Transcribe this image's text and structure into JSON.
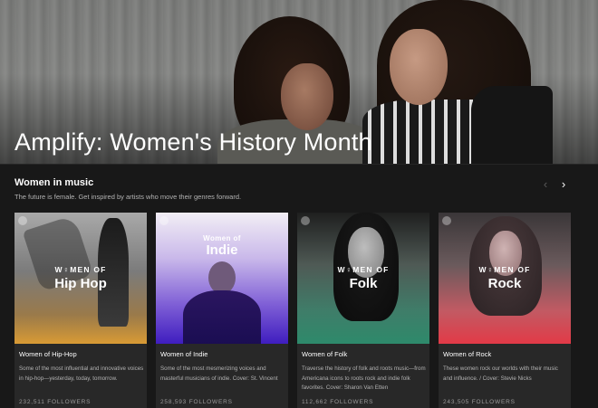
{
  "hero": {
    "title": "Amplify: Women's History Month"
  },
  "section": {
    "title": "Women in music",
    "subtitle": "The future is female. Get inspired by artists who move their genres forward.",
    "prev_arrow": "‹",
    "next_arrow": "›"
  },
  "cards": [
    {
      "cover_pre": "W♀MEN OF",
      "cover_main": "Hip Hop",
      "name": "Women of Hip-Hop",
      "description": "Some of the most influential and innovative voices in hip-hop—yesterday, today, tomorrow.",
      "followers": "232,511 FOLLOWERS"
    },
    {
      "cover_pre": "Women of",
      "cover_main": "Indie",
      "name": "Women of Indie",
      "description": "Some of the most mesmerizing voices and masterful musicians of indie. Cover: St. Vincent",
      "followers": "258,593 FOLLOWERS"
    },
    {
      "cover_pre": "W♀MEN OF",
      "cover_main": "Folk",
      "name": "Women of Folk",
      "description": "Traverse the history of folk and roots music—from Americana icons to roots rock and indie folk favorites. Cover: Sharon Van Etten",
      "followers": "112,662 FOLLOWERS"
    },
    {
      "cover_pre": "W♀MEN OF",
      "cover_main": "Rock",
      "name": "Women of Rock",
      "description": "These women rock our worlds with their music and influence. / Cover: Stevie Nicks",
      "followers": "243,505 FOLLOWERS"
    }
  ]
}
